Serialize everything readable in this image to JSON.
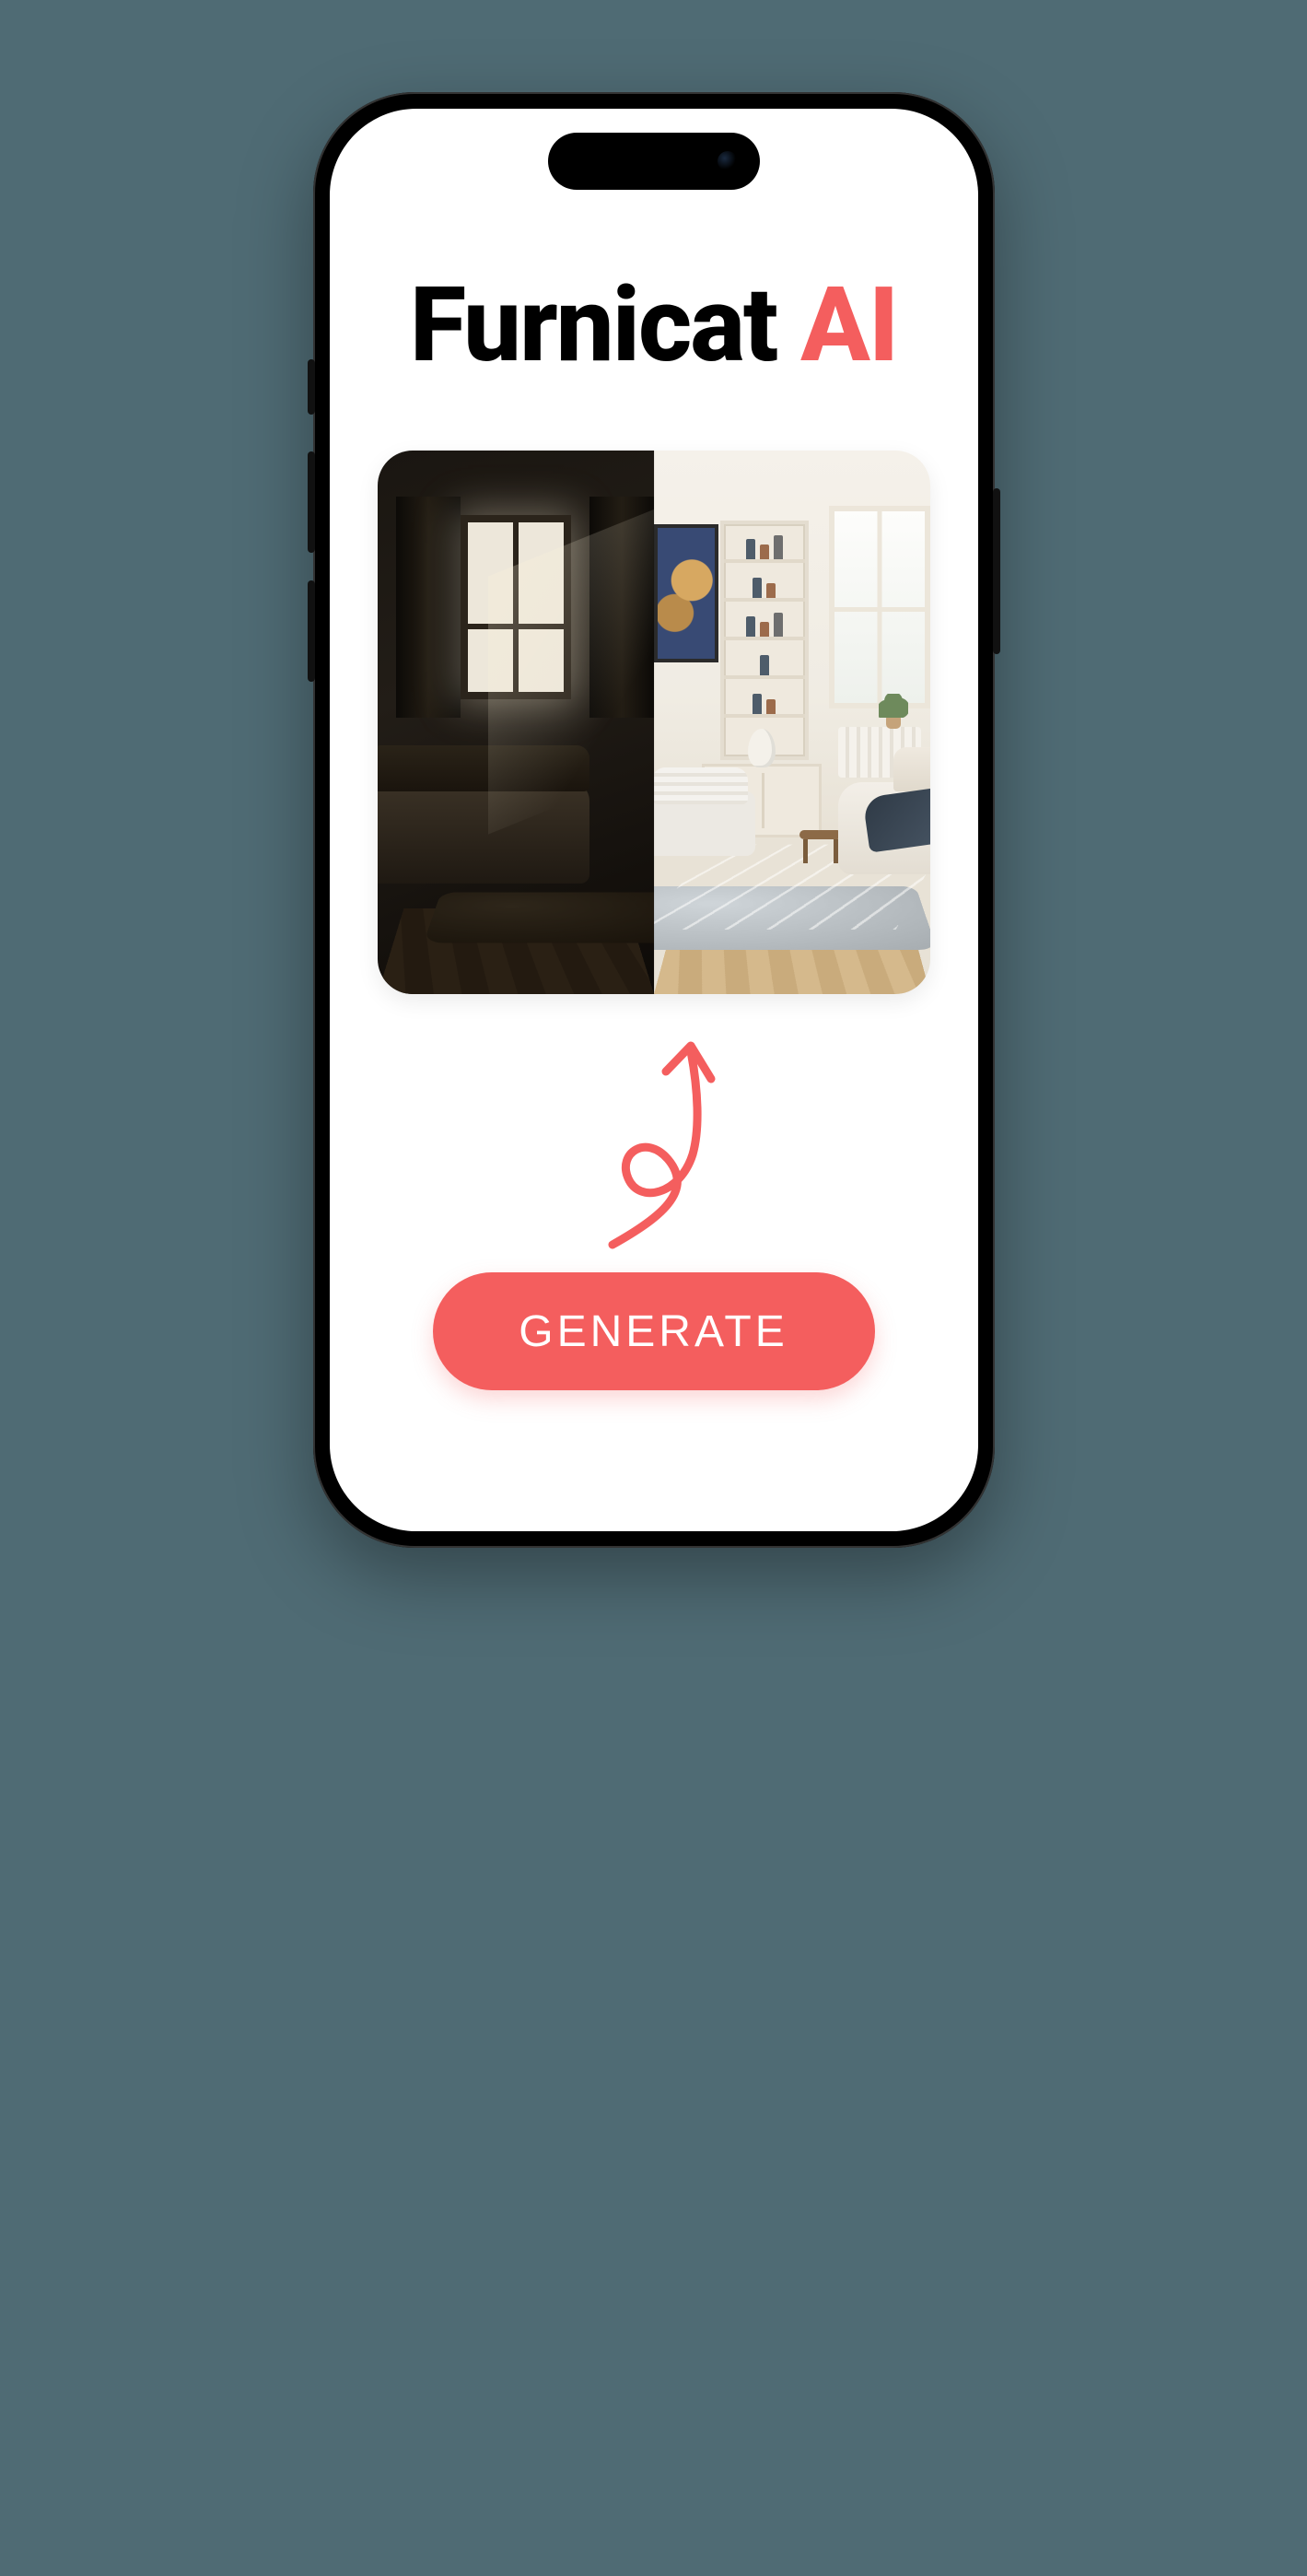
{
  "colors": {
    "background": "#4f6b74",
    "accent": "#f45e5e",
    "text": "#15181c"
  },
  "header": {
    "title_part1": "Furnicat",
    "title_part2": "AI"
  },
  "comparison": {
    "before_alt": "dark-living-room",
    "after_alt": "bright-redesigned-living-room"
  },
  "arrow": {
    "name": "curly-arrow-up"
  },
  "cta": {
    "generate_label": "GENERATE"
  }
}
